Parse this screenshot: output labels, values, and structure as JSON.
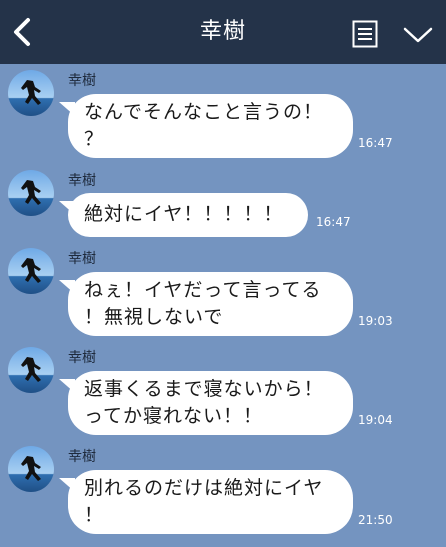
{
  "header": {
    "title": "幸樹"
  },
  "messages": [
    {
      "sender": "幸樹",
      "text": "なんでそんなこと言うの！\n？",
      "time": "16:47"
    },
    {
      "sender": "幸樹",
      "text": "絶対にイヤ！！！！！",
      "time": "16:47"
    },
    {
      "sender": "幸樹",
      "text": "ねぇ！イヤだって言ってる\n！無視しないで",
      "time": "19:03"
    },
    {
      "sender": "幸樹",
      "text": "返事くるまで寝ないから！\nってか寝れない！！",
      "time": "19:04"
    },
    {
      "sender": "幸樹",
      "text": "別れるのだけは絶対にイヤ\n！",
      "time": "21:50"
    }
  ],
  "colors": {
    "background": "#7494c0",
    "header": "#243349",
    "bubble": "#ffffff"
  }
}
